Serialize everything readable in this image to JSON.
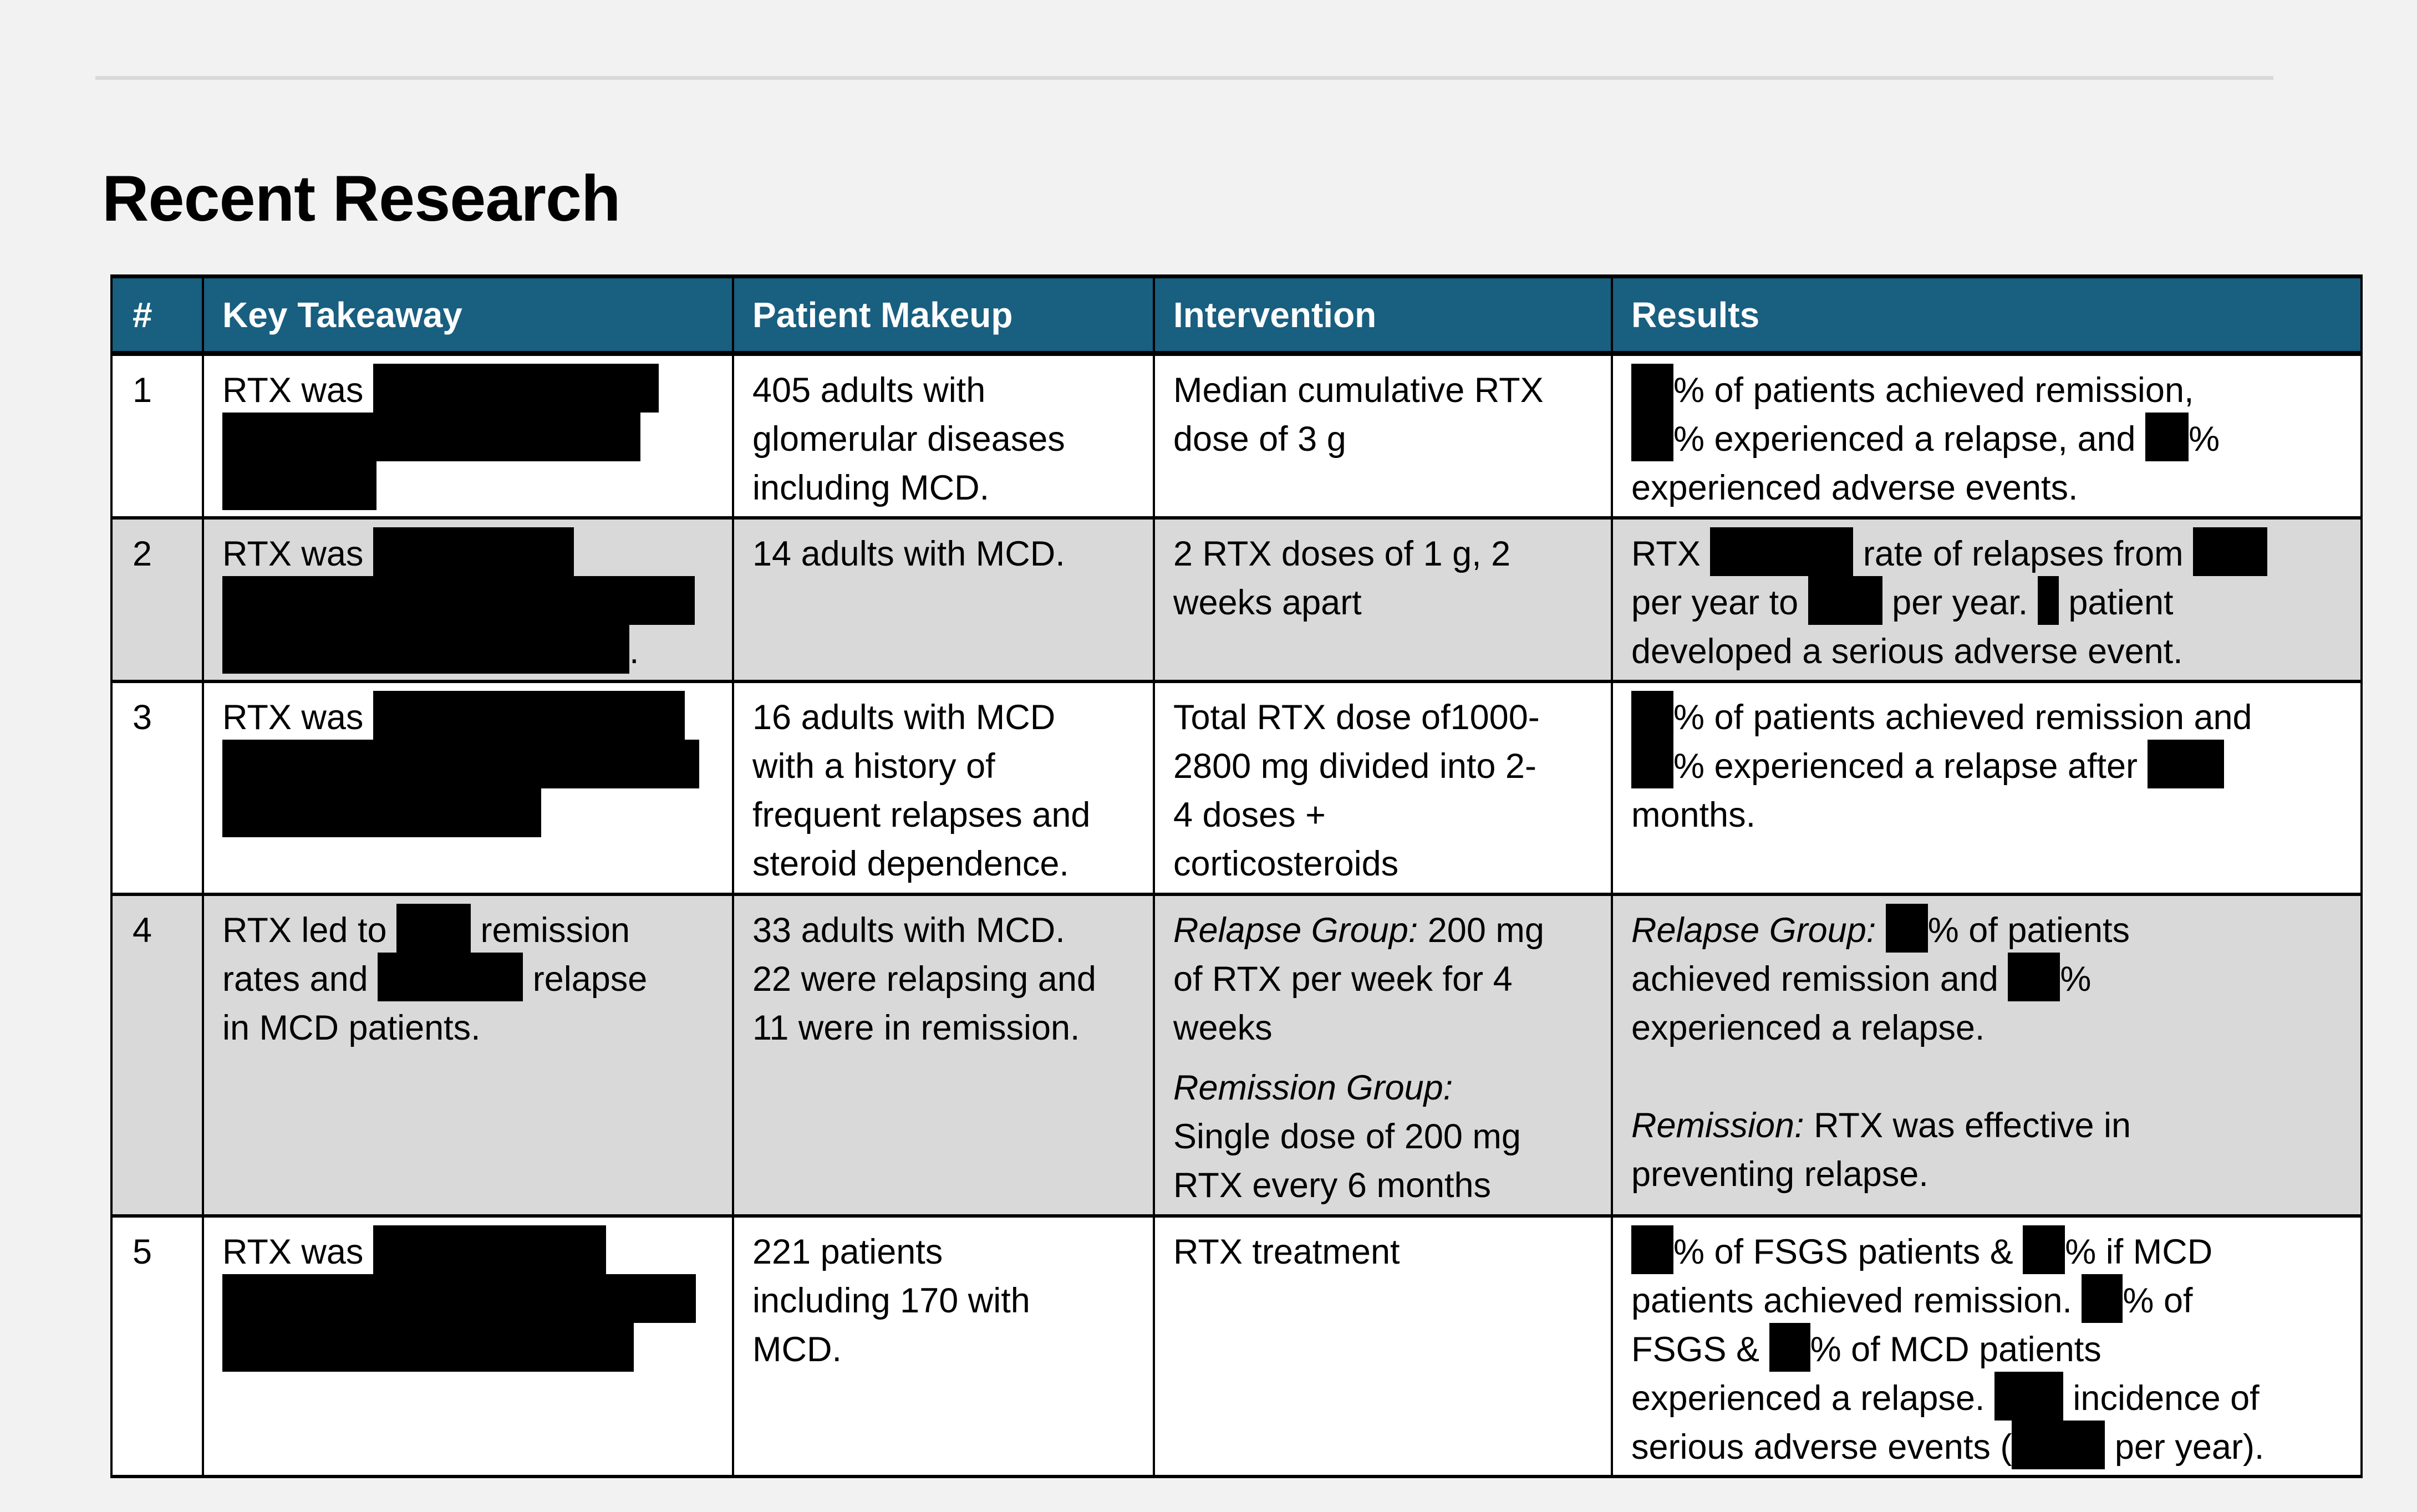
{
  "page": {
    "title": "Recent Research"
  },
  "table": {
    "columns": [
      "#",
      "Key Takeaway",
      "Patient Makeup",
      "Intervention",
      "Results"
    ],
    "colors": {
      "header_bg": "#185f80",
      "header_text": "#ffffff",
      "row_alt_bg": "#d9d9d9",
      "row_bg": "#ffffff",
      "redaction": "#000000"
    },
    "rows": [
      {
        "number": "1",
        "key_takeaway": [
          [
            {
              "t": "RTX was "
            },
            {
              "redacted": true
            }
          ],
          [
            {
              "redacted": true
            }
          ],
          [
            {
              "redacted": true
            }
          ]
        ],
        "patient_makeup": [
          [
            {
              "t": "405 adults with"
            }
          ],
          [
            {
              "t": "glomerular diseases"
            }
          ],
          [
            {
              "t": "including MCD."
            }
          ]
        ],
        "intervention": [
          [
            {
              "t": "Median cumulative RTX"
            }
          ],
          [
            {
              "t": "dose of 3 g"
            }
          ]
        ],
        "results": [
          [
            {
              "redacted": true
            },
            {
              "t": "% of patients achieved remission,"
            }
          ],
          [
            {
              "redacted": true
            },
            {
              "t": "% experienced a relapse, and "
            },
            {
              "redacted": true
            },
            {
              "t": "%"
            }
          ],
          [
            {
              "t": "experienced adverse events."
            }
          ]
        ]
      },
      {
        "number": "2",
        "key_takeaway": [
          [
            {
              "t": "RTX was "
            },
            {
              "redacted": true
            }
          ],
          [
            {
              "redacted": true
            }
          ],
          [
            {
              "redacted": true
            },
            {
              "t": "."
            }
          ]
        ],
        "patient_makeup": [
          [
            {
              "t": "14 adults with MCD."
            }
          ]
        ],
        "intervention": [
          [
            {
              "t": "2 RTX doses of 1 g, 2"
            }
          ],
          [
            {
              "t": "weeks apart"
            }
          ]
        ],
        "results": [
          [
            {
              "t": "RTX "
            },
            {
              "redacted": true
            },
            {
              "t": " rate of relapses from "
            },
            {
              "redacted": true
            }
          ],
          [
            {
              "t": "per year to "
            },
            {
              "redacted": true
            },
            {
              "t": " per year. "
            },
            {
              "redacted": true
            },
            {
              "t": " patient"
            }
          ],
          [
            {
              "t": "developed a serious adverse event."
            }
          ]
        ]
      },
      {
        "number": "3",
        "key_takeaway": [
          [
            {
              "t": "RTX was "
            },
            {
              "redacted": true
            }
          ],
          [
            {
              "redacted": true
            }
          ],
          [
            {
              "redacted": true
            }
          ]
        ],
        "patient_makeup": [
          [
            {
              "t": "16 adults with MCD"
            }
          ],
          [
            {
              "t": "with a history of"
            }
          ],
          [
            {
              "t": "frequent relapses and"
            }
          ],
          [
            {
              "t": "steroid dependence."
            }
          ]
        ],
        "intervention": [
          [
            {
              "t": "Total RTX dose of1000-"
            }
          ],
          [
            {
              "t": "2800 mg divided into 2-"
            }
          ],
          [
            {
              "t": "4 doses +"
            }
          ],
          [
            {
              "t": "corticosteroids"
            }
          ]
        ],
        "results": [
          [
            {
              "redacted": true
            },
            {
              "t": "% of patients achieved remission and"
            }
          ],
          [
            {
              "redacted": true
            },
            {
              "t": "% experienced a relapse after "
            },
            {
              "redacted": true
            }
          ],
          [
            {
              "t": "months."
            }
          ]
        ]
      },
      {
        "number": "4",
        "key_takeaway": [
          [
            {
              "t": "RTX led to "
            },
            {
              "redacted": true
            },
            {
              "t": " remission"
            }
          ],
          [
            {
              "t": "rates and "
            },
            {
              "redacted": true
            },
            {
              "t": " relapse"
            }
          ],
          [
            {
              "t": "in MCD patients."
            }
          ]
        ],
        "patient_makeup": [
          [
            {
              "t": "33 adults with MCD."
            }
          ],
          [
            {
              "t": "22 were relapsing and"
            }
          ],
          [
            {
              "t": "11 were in remission."
            }
          ]
        ],
        "intervention": [
          [
            {
              "i": "Relapse Group:"
            },
            {
              "t": " 200 mg"
            }
          ],
          [
            {
              "t": "of RTX per week for 4"
            }
          ],
          [
            {
              "t": "weeks"
            }
          ],
          [
            {
              "gap": true
            }
          ],
          [
            {
              "i": "Remission Group:"
            }
          ],
          [
            {
              "t": "Single dose of 200 mg"
            }
          ],
          [
            {
              "t": "RTX every 6 months"
            }
          ]
        ],
        "results": [
          [
            {
              "i": "Relapse Group:"
            },
            {
              "t": " "
            },
            {
              "redacted": true
            },
            {
              "t": "% of patients"
            }
          ],
          [
            {
              "t": "achieved remission and "
            },
            {
              "redacted": true
            },
            {
              "t": "%"
            }
          ],
          [
            {
              "t": "experienced a relapse."
            }
          ],
          [
            {
              "blank": true
            }
          ],
          [
            {
              "i": "Remission:"
            },
            {
              "t": " RTX was effective in"
            }
          ],
          [
            {
              "t": "preventing relapse."
            }
          ]
        ]
      },
      {
        "number": "5",
        "key_takeaway": [
          [
            {
              "t": "RTX was "
            },
            {
              "redacted": true
            }
          ],
          [
            {
              "redacted": true
            }
          ],
          [
            {
              "redacted": true
            }
          ]
        ],
        "patient_makeup": [
          [
            {
              "t": "221 patients"
            }
          ],
          [
            {
              "t": "including 170 with"
            }
          ],
          [
            {
              "t": "MCD."
            }
          ]
        ],
        "intervention": [
          [
            {
              "t": "RTX treatment"
            }
          ]
        ],
        "results": [
          [
            {
              "redacted": true
            },
            {
              "t": "% of FSGS patients & "
            },
            {
              "redacted": true
            },
            {
              "t": "% if MCD"
            }
          ],
          [
            {
              "t": "patients achieved remission. "
            },
            {
              "redacted": true
            },
            {
              "t": "% of"
            }
          ],
          [
            {
              "t": "FSGS & "
            },
            {
              "redacted": true
            },
            {
              "t": "% of MCD patients"
            }
          ],
          [
            {
              "t": "experienced a relapse. "
            },
            {
              "redacted": true
            },
            {
              "t": " incidence of"
            }
          ],
          [
            {
              "t": "serious adverse events ("
            },
            {
              "redacted": true
            },
            {
              "t": " per year)."
            }
          ]
        ]
      }
    ]
  }
}
